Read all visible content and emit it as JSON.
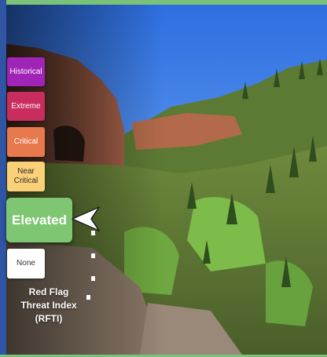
{
  "legend": {
    "levels": [
      {
        "label": "Historical",
        "color": "#a024b5"
      },
      {
        "label": "Extreme",
        "color": "#c82d5d"
      },
      {
        "label": "Critical",
        "color": "#e8794c"
      },
      {
        "label": "Near\nCritical",
        "color": "#fbd178"
      },
      {
        "label": "Elevated",
        "color": "#7fc672",
        "current": true
      },
      {
        "label": "None",
        "color": "#ffffff"
      }
    ],
    "caption": "Red Flag\nThreat Index\n(RFTI)"
  },
  "frame": {
    "top_bar_color": "#7ac27a",
    "left_bar_color": "#2f55a4"
  }
}
